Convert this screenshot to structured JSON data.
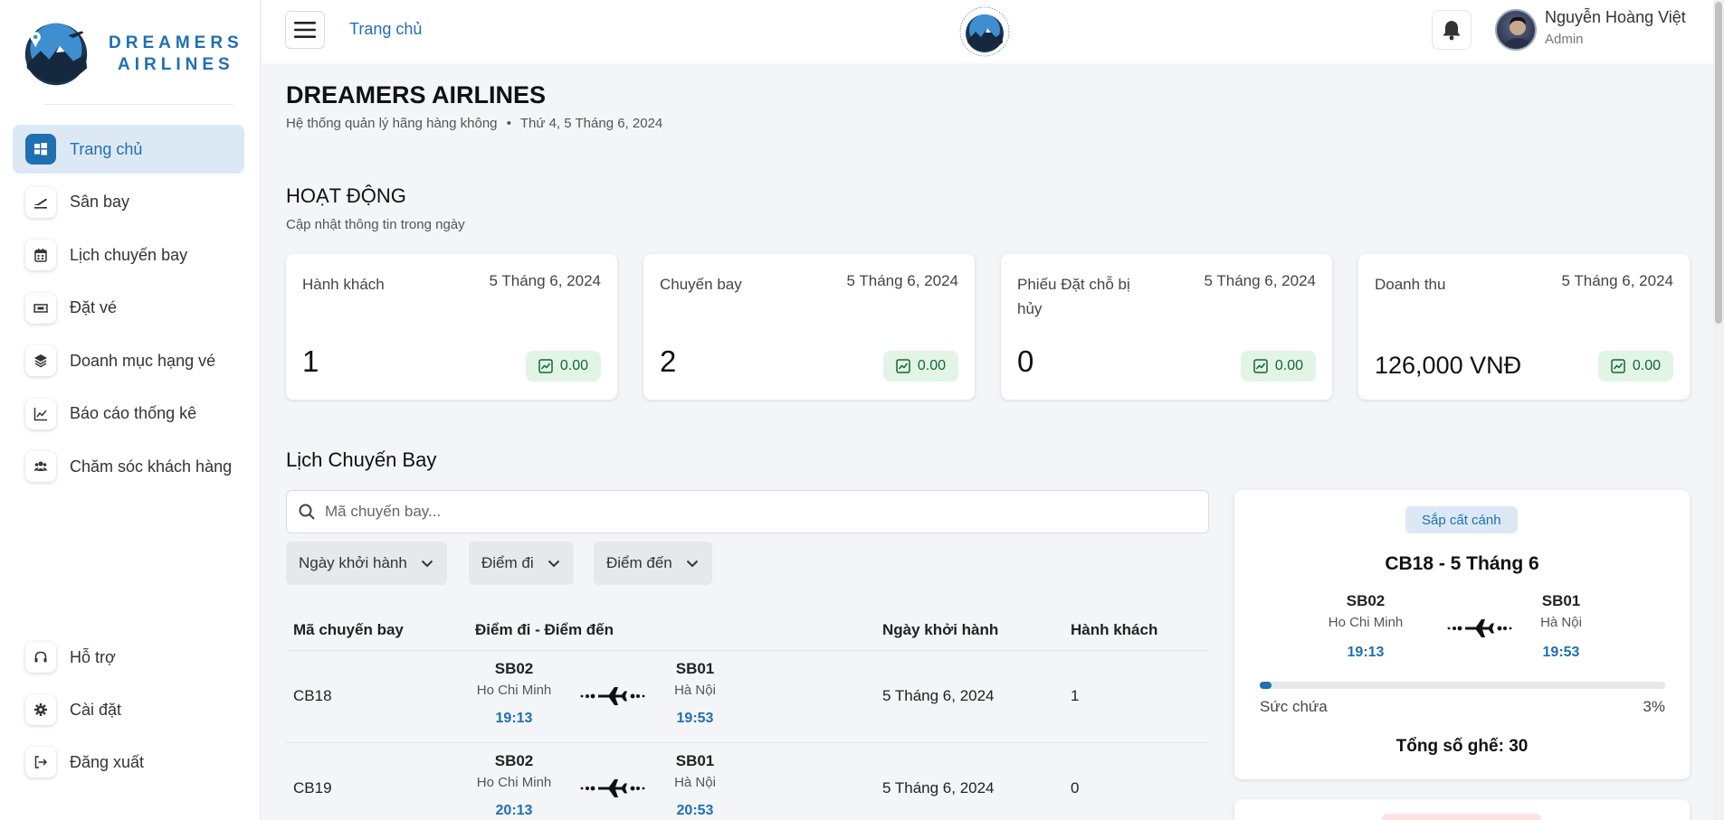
{
  "brand": {
    "line1": "DREAMERS",
    "line2": "AIRLINES"
  },
  "sidebar": {
    "items": [
      {
        "label": "Trang chủ",
        "icon": "windows-icon",
        "active": true
      },
      {
        "label": "Sân bay",
        "icon": "plane-departure-icon"
      },
      {
        "label": "Lịch chuyến bay",
        "icon": "calendar-icon"
      },
      {
        "label": "Đặt vé",
        "icon": "ticket-icon"
      },
      {
        "label": "Doanh mục hạng vé",
        "icon": "layers-icon"
      },
      {
        "label": "Báo cáo thống kê",
        "icon": "chart-line-icon"
      },
      {
        "label": "Chăm sóc khách hàng",
        "icon": "users-icon"
      }
    ],
    "bottom": [
      {
        "label": "Hỗ trợ",
        "icon": "headset-icon"
      },
      {
        "label": "Cài đặt",
        "icon": "gear-icon"
      },
      {
        "label": "Đăng xuất",
        "icon": "logout-icon"
      }
    ]
  },
  "header": {
    "breadcrumb": "Trang chủ",
    "user_name": "Nguyễn Hoàng Việt",
    "user_role": "Admin"
  },
  "page": {
    "title": "DREAMERS AIRLINES",
    "subtitle": "Hệ thống quản lý hãng hàng không",
    "date": "Thứ 4, 5 Tháng 6, 2024"
  },
  "activity": {
    "title": "HOẠT ĐỘNG",
    "subtitle": "Cập nhật thông tin trong ngày",
    "cards": [
      {
        "label": "Hành khách",
        "date": "5 Tháng 6, 2024",
        "value": "1",
        "change": "0.00"
      },
      {
        "label": "Chuyến bay",
        "date": "5 Tháng 6, 2024",
        "value": "2",
        "change": "0.00"
      },
      {
        "label": "Phiếu Đặt chỗ bị hủy",
        "date": "5 Tháng 6, 2024",
        "value": "0",
        "change": "0.00"
      },
      {
        "label": "Doanh thu",
        "date": "5 Tháng 6, 2024",
        "value": "126,000 VNĐ",
        "change": "0.00"
      }
    ]
  },
  "schedule": {
    "title": "Lịch Chuyến Bay",
    "search_placeholder": "Mã chuyến bay...",
    "filters": [
      "Ngày khởi hành",
      "Điểm đi",
      "Điểm đến"
    ],
    "columns": [
      "Mã chuyến bay",
      "Điểm đi - Điểm đến",
      "Ngày khởi hành",
      "Hành khách"
    ],
    "rows": [
      {
        "id": "CB18",
        "from_code": "SB02",
        "from_city": "Ho Chi Minh",
        "from_time": "19:13",
        "to_code": "SB01",
        "to_city": "Hà Nội",
        "to_time": "19:53",
        "date": "5 Tháng 6, 2024",
        "passengers": "1"
      },
      {
        "id": "CB19",
        "from_code": "SB02",
        "from_city": "Ho Chi Minh",
        "from_time": "20:13",
        "to_code": "SB01",
        "to_city": "Hà Nội",
        "to_time": "20:53",
        "date": "5 Tháng 6, 2024",
        "passengers": "0"
      }
    ]
  },
  "upcoming": {
    "status": "Sắp cất cánh",
    "title": "CB18 - 5 Tháng 6",
    "from_code": "SB02",
    "from_city": "Ho Chi Minh",
    "from_time": "19:13",
    "to_code": "SB01",
    "to_city": "Hà Nội",
    "to_time": "19:53",
    "capacity_label": "Sức chứa",
    "capacity_pct_text": "3%",
    "capacity_fraction": 0.03,
    "seats": "Tổng số ghế: 30"
  },
  "colors": {
    "accent": "#1f6fb2",
    "active_bg": "#dce9f5",
    "badge_green_bg": "#e1f4e6",
    "badge_green_text": "#166534"
  }
}
